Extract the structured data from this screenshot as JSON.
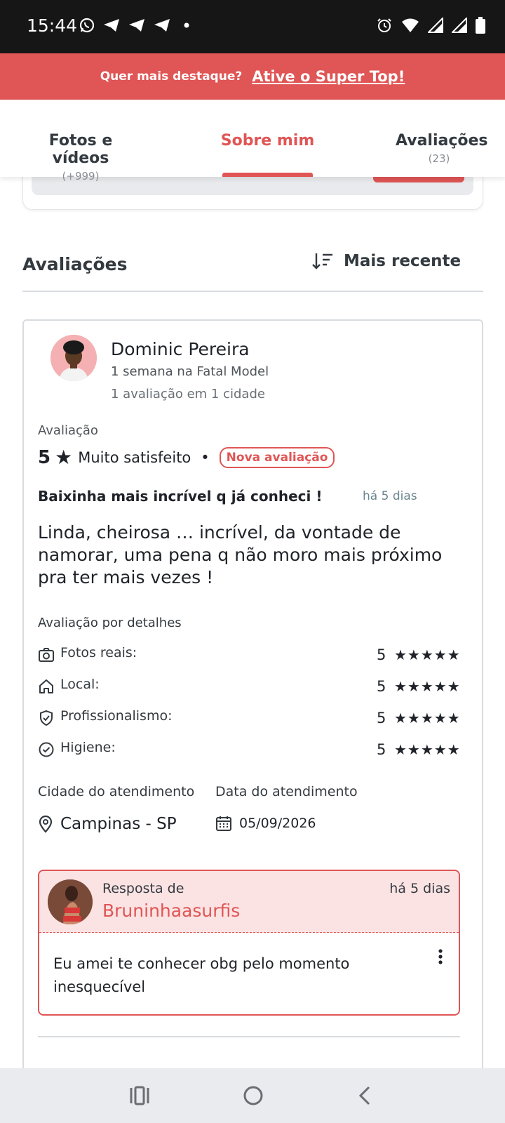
{
  "status_bar": {
    "time": "15:44",
    "left_icons": [
      "whatsapp-icon",
      "telegram-icon",
      "telegram-icon",
      "telegram-icon",
      "dot-icon"
    ],
    "right_icons": [
      "alarm-icon",
      "wifi-icon",
      "signal-icon",
      "signal-icon",
      "battery-icon"
    ]
  },
  "promo": {
    "question": "Quer mais destaque?",
    "cta": "Ative o Super Top!",
    "color": "#e05555"
  },
  "tabs": [
    {
      "label": "Fotos e vídeos",
      "count": "(+999)"
    },
    {
      "label": "Sobre mim",
      "count": ""
    },
    {
      "label": "Avaliações",
      "count": "(23)"
    }
  ],
  "active_tab": "Sobre mim",
  "reviews_section": {
    "title": "Avaliações",
    "sort_label": "Mais recente",
    "sort_icon": "sort-descending-icon"
  },
  "review": {
    "user_name": "Dominic Pereira",
    "user_meta_1": "1 semana na Fatal Model",
    "user_meta_2": "1 avaliação em 1 cidade",
    "rating_label": "Avaliação",
    "rating_value": "5",
    "rating_star": "★",
    "rating_text": "Muito satisfeito",
    "separator": "•",
    "new_badge": "Nova avaliação",
    "title": "Baixinha mais incrível q já conheci !",
    "time_ago": "há 5 dias",
    "body": "Linda, cheirosa … incrível, da vontade de namorar, uma pena q não moro mais próximo pra ter mais vezes !",
    "details_label": "Avaliação por detalhes",
    "details": [
      {
        "icon": "camera-icon",
        "name": "Fotos reais:",
        "score": "5",
        "stars": "★★★★★"
      },
      {
        "icon": "home-icon",
        "name": "Local:",
        "score": "5",
        "stars": "★★★★★"
      },
      {
        "icon": "shield-check-icon",
        "name": "Profissionalismo:",
        "score": "5",
        "stars": "★★★★★"
      },
      {
        "icon": "check-circle-icon",
        "name": "Higiene:",
        "score": "5",
        "stars": "★★★★★"
      }
    ],
    "city_header": "Cidade do atendimento",
    "city_value": "Campinas - SP",
    "date_header": "Data do atendimento",
    "date_value": "05/09/2026",
    "reply": {
      "from_label": "Resposta de",
      "author": "Bruninhaasurfis",
      "time_ago": "há 5 dias",
      "message": "Eu amei te conhecer obg pelo momento inesquecível"
    }
  },
  "nav_bar": {
    "buttons": [
      "recent-apps-icon",
      "home-circle-icon",
      "back-icon"
    ]
  }
}
